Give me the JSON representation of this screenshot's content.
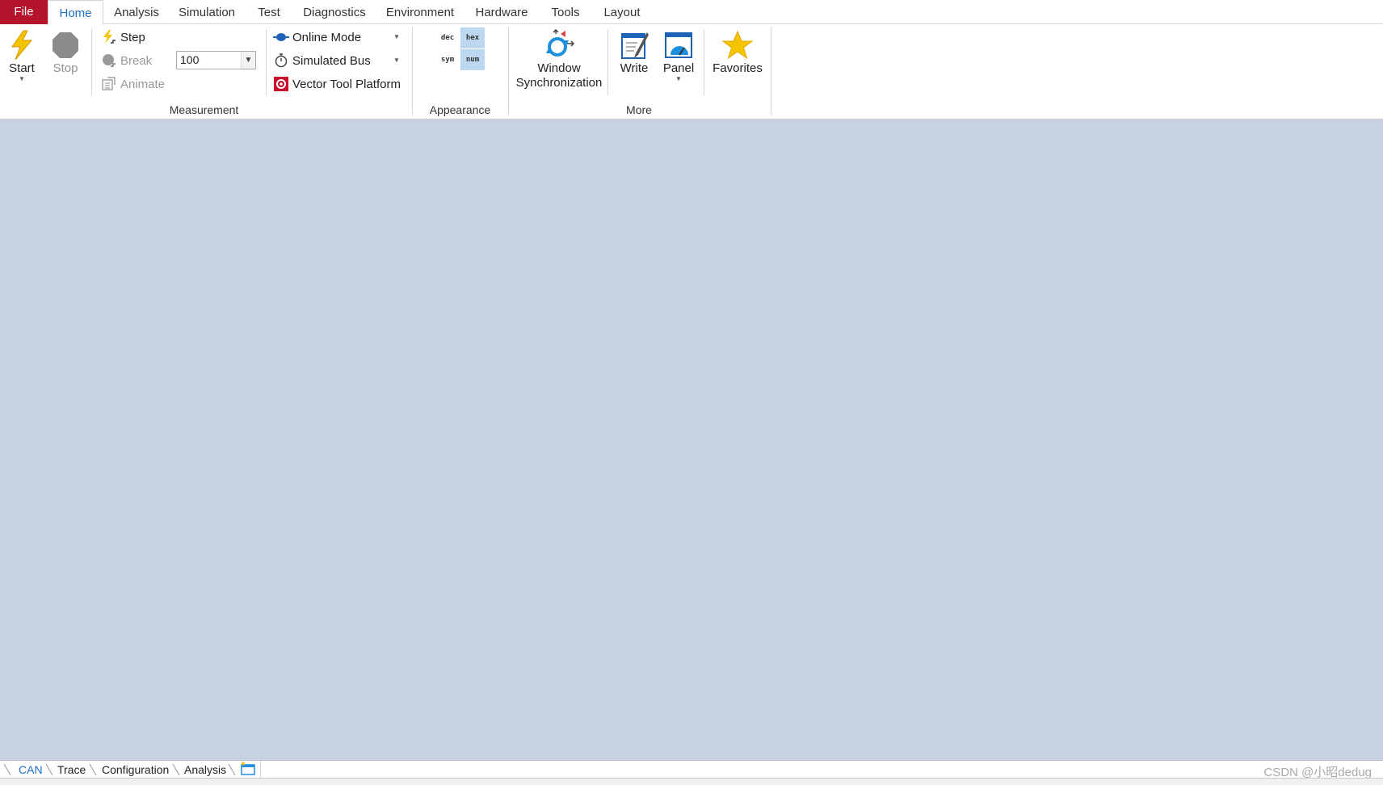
{
  "tabs": [
    {
      "label": "File"
    },
    {
      "label": "Home"
    },
    {
      "label": "Analysis"
    },
    {
      "label": "Simulation"
    },
    {
      "label": "Test"
    },
    {
      "label": "Diagnostics"
    },
    {
      "label": "Environment"
    },
    {
      "label": "Hardware"
    },
    {
      "label": "Tools"
    },
    {
      "label": "Layout"
    }
  ],
  "ribbon": {
    "measurement": {
      "label": "Measurement",
      "start": "Start",
      "stop": "Stop",
      "step": "Step",
      "break": "Break",
      "animate": "Animate",
      "animate_delay": "100",
      "online_mode": "Online Mode",
      "simulated_bus": "Simulated Bus",
      "vector_tool_platform": "Vector Tool Platform"
    },
    "appearance": {
      "label": "Appearance",
      "dec": "dec",
      "hex": "hex",
      "sym": "sym",
      "num": "num"
    },
    "more": {
      "label": "More",
      "window_sync_line1": "Window",
      "window_sync_line2": "Synchronization",
      "write": "Write",
      "panel": "Panel",
      "favorites": "Favorites"
    }
  },
  "bottom_tabs": [
    {
      "label": "CAN"
    },
    {
      "label": "Trace"
    },
    {
      "label": "Configuration"
    },
    {
      "label": "Analysis"
    }
  ],
  "watermark": "CSDN @小昭dedug",
  "colors": {
    "file_tab": "#b5122b",
    "accent": "#1e6fc8",
    "workspace": "#c8d1e2",
    "format_selected": "#bcd7ef"
  }
}
